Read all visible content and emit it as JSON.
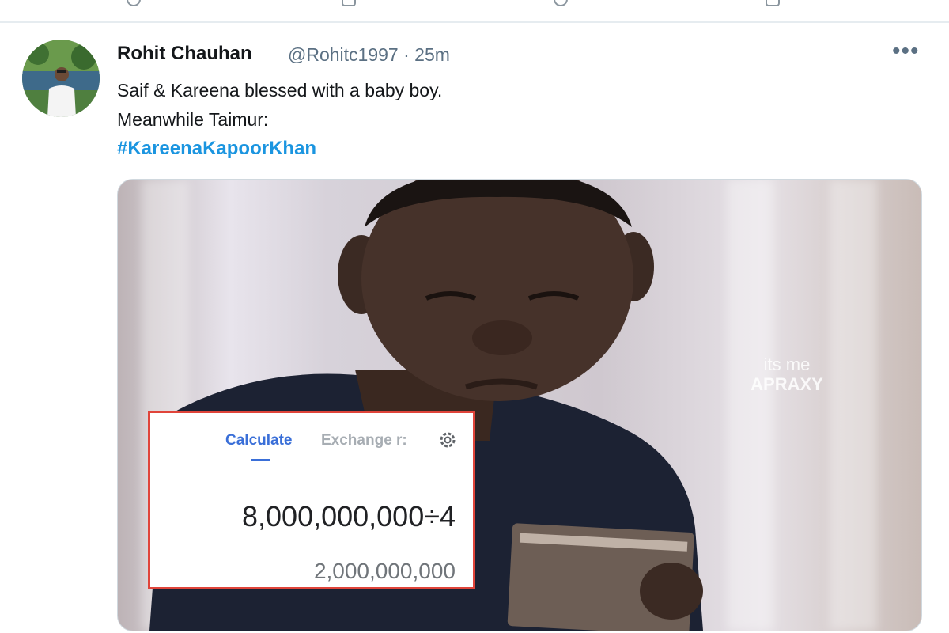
{
  "tweet": {
    "author_name": "Rohit Chauhan",
    "handle": "@Rohitc1997",
    "separator": "·",
    "time": "25m",
    "text_line1": "Saif & Kareena blessed with a baby boy.",
    "text_line2": "Meanwhile Taimur:",
    "hashtag": "#KareenaKapoorKhan",
    "more_icon": "more-horizontal-icon"
  },
  "media": {
    "watermark_line1": "its me",
    "watermark_line2": "APRAXY",
    "calculator": {
      "tab_active": "Calculate",
      "tab_inactive": "Exchange r:",
      "settings_icon": "gear-icon",
      "expression": "8,000,000,000÷4",
      "result": "2,000,000,000",
      "accent": "#3a6fd8",
      "border_color": "#e0443a"
    }
  },
  "colors": {
    "link": "#1b95e0",
    "secondary_text": "#5b7083"
  }
}
